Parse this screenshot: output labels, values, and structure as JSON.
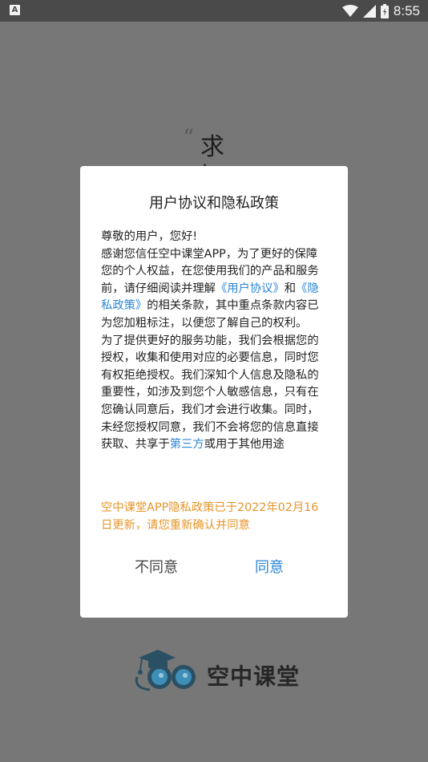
{
  "status_bar": {
    "time": "8:55",
    "left_icon_label": "A",
    "icons": [
      "wifi-icon",
      "signal-icon",
      "battery-icon"
    ]
  },
  "splash": {
    "quote_mark": "“",
    "quote_text_line1": "求",
    "quote_text_line2": "知",
    "brand_name": "空中课堂",
    "logo_icon": "mortarboard-owl-logo"
  },
  "dialog": {
    "title": "用户协议和隐私政策",
    "greeting": "尊敬的用户，您好!",
    "p1_part1": "感谢您信任空中课堂APP，为了更好的保障您的个人权益，在您使用我们的产品和服务前，请仔细阅读并理解",
    "link_user_agreement": "《用户协议》",
    "p1_and": "和",
    "link_privacy_policy": "《隐私政策》",
    "p1_part2": "的相关条款，其中重点条款内容已为您加粗标注，以便您了解自己的权利。",
    "p2_part1": "为了提供更好的服务功能，我们会根据您的授权，收集和使用对应的必要信息，同时您有权拒绝授权。我们深知个人信息及隐私的重要性，如涉及到您个人敏感信息，只有在您确认同意后，我们才会进行收集。同时，未经您授权同意，我们不会将您的信息直接获取、共享于",
    "link_third_party": "第三方",
    "p2_part2": "或用于其他用途",
    "notice": "空中课堂APP隐私政策已于2022年02月16日更新，请您重新确认并同意",
    "disagree_label": "不同意",
    "agree_label": "同意"
  },
  "colors": {
    "link": "#2a86d6",
    "notice": "#e6952a",
    "overlay": "#777777"
  }
}
